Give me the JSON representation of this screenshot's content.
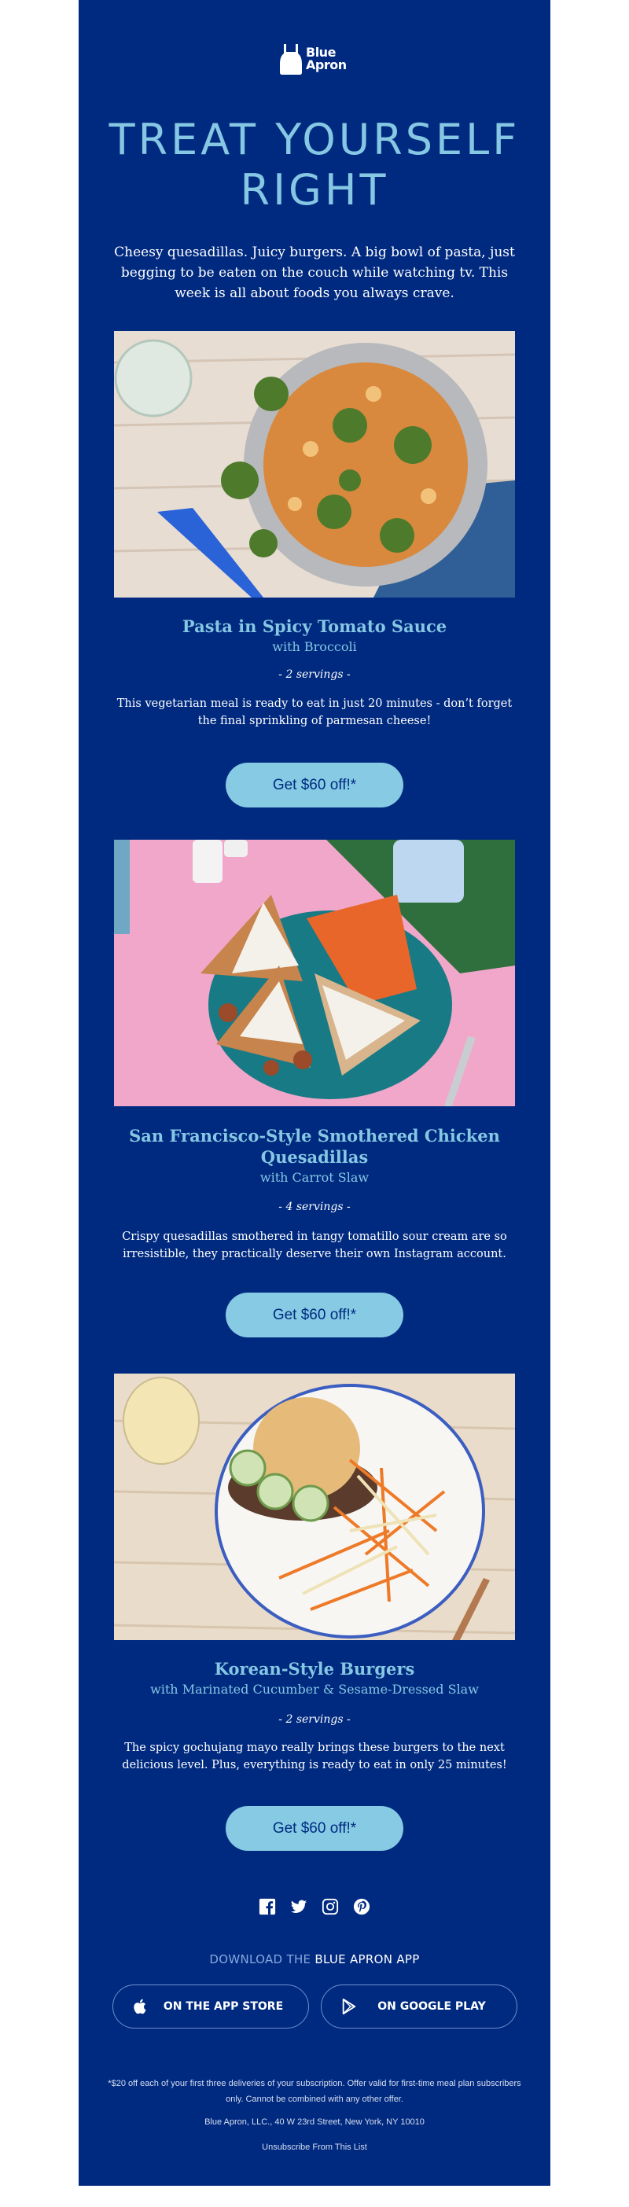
{
  "brand": {
    "name_line1": "Blue",
    "name_line2": "Apron",
    "colors": {
      "background": "#002a80",
      "accent": "#86c7e3",
      "button": "#86cbe3",
      "text": "#ffffff"
    }
  },
  "hero": {
    "headline_line1": "TREAT YOURSELF",
    "headline_line2": "RIGHT",
    "intro": "Cheesy quesadillas. Juicy burgers. A big bowl of pasta, just begging to be eaten on the couch while watching tv. This week is all about foods you always crave."
  },
  "recipes": [
    {
      "image_alt": "Pasta in spicy tomato sauce with broccoli in a grey bowl",
      "title": "Pasta in Spicy Tomato Sauce",
      "subtitle": "with Broccoli",
      "servings": "- 2 servings -",
      "description": "This vegetarian meal is ready to eat in just 20 minutes - don’t forget the final sprinkling of parmesan cheese!",
      "cta": "Get $60 off!*"
    },
    {
      "image_alt": "Smothered chicken quesadillas with carrot slaw on a teal plate",
      "title": "San Francisco-Style Smothered Chicken Quesadillas",
      "subtitle": "with Carrot Slaw",
      "servings": "- 4 servings -",
      "description": "Crispy quesadillas smothered in tangy tomatillo sour cream are so irresistible, they practically deserve their own Instagram account.",
      "cta": "Get $60 off!*"
    },
    {
      "image_alt": "Korean-style burger with cucumber and slaw on a white plate",
      "title": "Korean-Style Burgers",
      "subtitle": "with Marinated Cucumber & Sesame-Dressed Slaw",
      "servings": "- 2 servings -",
      "description": "The spicy gochujang mayo really brings these burgers to the next delicious level. Plus, everything is ready to eat in only 25 minutes!",
      "cta": "Get $60 off!*"
    }
  ],
  "social": {
    "icons": [
      "facebook-icon",
      "twitter-icon",
      "instagram-icon",
      "pinterest-icon"
    ]
  },
  "download": {
    "prefix": "DOWNLOAD THE ",
    "emphasis": "BLUE APRON APP",
    "app_store": "ON THE APP STORE",
    "google_play": "ON GOOGLE PLAY"
  },
  "footer": {
    "disclaimer": "*$20 off each of your first three deliveries of your subscription. Offer valid for first-time meal plan subscribers only. Cannot be combined with any other offer.",
    "address": "Blue Apron, LLC., 40 W 23rd Street, New York, NY 10010",
    "unsubscribe": "Unsubscribe From This List"
  }
}
